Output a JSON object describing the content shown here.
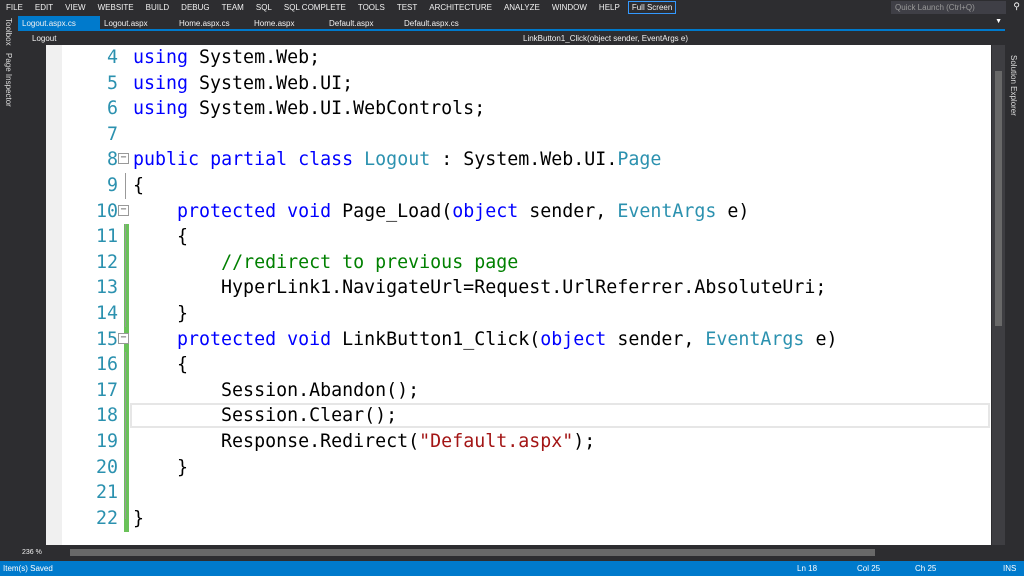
{
  "menu": [
    "FILE",
    "EDIT",
    "VIEW",
    "WEBSITE",
    "BUILD",
    "DEBUG",
    "TEAM",
    "SQL",
    "SQL COMPLETE",
    "TOOLS",
    "TEST",
    "ARCHITECTURE",
    "ANALYZE",
    "WINDOW",
    "HELP"
  ],
  "full_screen": "Full Screen",
  "quick_launch_placeholder": "Quick Launch (Ctrl+Q)",
  "left_panels": [
    "Toolbox",
    "Page Inspector"
  ],
  "right_panels": [
    "Solution Explorer"
  ],
  "tabs": [
    {
      "label": "Logout.aspx.cs",
      "active": true
    },
    {
      "label": "Logout.aspx"
    },
    {
      "label": "Home.aspx.cs"
    },
    {
      "label": "Home.aspx"
    },
    {
      "label": "Default.aspx"
    },
    {
      "label": "Default.aspx.cs"
    }
  ],
  "nav": {
    "class": "Logout",
    "member": "LinkButton1_Click(object sender, EventArgs e)"
  },
  "code": [
    {
      "n": "4",
      "t": [
        [
          "using",
          "kw"
        ],
        [
          " System.Web;",
          ""
        ]
      ]
    },
    {
      "n": "5",
      "t": [
        [
          "using",
          "kw"
        ],
        [
          " System.Web.UI;",
          ""
        ]
      ]
    },
    {
      "n": "6",
      "t": [
        [
          "using",
          "kw"
        ],
        [
          " System.Web.UI.WebControls;",
          ""
        ]
      ]
    },
    {
      "n": "7",
      "t": []
    },
    {
      "n": "8",
      "fold": true,
      "t": [
        [
          "public",
          "kw"
        ],
        [
          " ",
          ""
        ],
        [
          "partial",
          "kw"
        ],
        [
          " ",
          ""
        ],
        [
          "class",
          "kw"
        ],
        [
          " ",
          ""
        ],
        [
          "Logout",
          "ty"
        ],
        [
          " : System.Web.UI.",
          ""
        ],
        [
          "Page",
          "ty"
        ]
      ]
    },
    {
      "n": "9",
      "t": [
        [
          "{",
          ""
        ]
      ]
    },
    {
      "n": "10",
      "fold": true,
      "t": [
        [
          "    ",
          ""
        ],
        [
          "protected",
          "kw"
        ],
        [
          " ",
          ""
        ],
        [
          "void",
          "kw"
        ],
        [
          " Page_Load(",
          ""
        ],
        [
          "object",
          "kw"
        ],
        [
          " sender, ",
          ""
        ],
        [
          "EventArgs",
          "ty"
        ],
        [
          " e)",
          ""
        ]
      ]
    },
    {
      "n": "11",
      "chg": true,
      "t": [
        [
          "    {",
          ""
        ]
      ]
    },
    {
      "n": "12",
      "chg": true,
      "t": [
        [
          "        ",
          ""
        ],
        [
          "//redirect to previous page",
          "cm"
        ]
      ]
    },
    {
      "n": "13",
      "chg": true,
      "t": [
        [
          "        HyperLink1.NavigateUrl=Request.UrlReferrer.AbsoluteUri;",
          ""
        ]
      ]
    },
    {
      "n": "14",
      "chg": true,
      "t": [
        [
          "    }",
          ""
        ]
      ]
    },
    {
      "n": "15",
      "chg": true,
      "fold": true,
      "t": [
        [
          "    ",
          ""
        ],
        [
          "protected",
          "kw"
        ],
        [
          " ",
          ""
        ],
        [
          "void",
          "kw"
        ],
        [
          " LinkButton1_Click(",
          ""
        ],
        [
          "object",
          "kw"
        ],
        [
          " sender, ",
          ""
        ],
        [
          "EventArgs",
          "ty"
        ],
        [
          " e)",
          ""
        ]
      ]
    },
    {
      "n": "16",
      "chg": true,
      "t": [
        [
          "    {",
          ""
        ]
      ]
    },
    {
      "n": "17",
      "chg": true,
      "t": [
        [
          "        Session.Abandon();",
          ""
        ]
      ]
    },
    {
      "n": "18",
      "chg": true,
      "cur": true,
      "t": [
        [
          "        Session.Clear();",
          ""
        ]
      ]
    },
    {
      "n": "19",
      "chg": true,
      "t": [
        [
          "        Response.Redirect(",
          ""
        ],
        [
          "\"Default.aspx\"",
          "st"
        ],
        [
          ");",
          ""
        ]
      ]
    },
    {
      "n": "20",
      "chg": true,
      "t": [
        [
          "    }",
          ""
        ]
      ]
    },
    {
      "n": "21",
      "chg": true,
      "t": []
    },
    {
      "n": "22",
      "chg": true,
      "t": [
        [
          "}",
          ""
        ]
      ]
    }
  ],
  "zoom_level": "236 %",
  "status": {
    "message": "Item(s) Saved",
    "ln": "Ln 18",
    "col": "Col 25",
    "ch": "Ch 25",
    "mode": "INS"
  }
}
